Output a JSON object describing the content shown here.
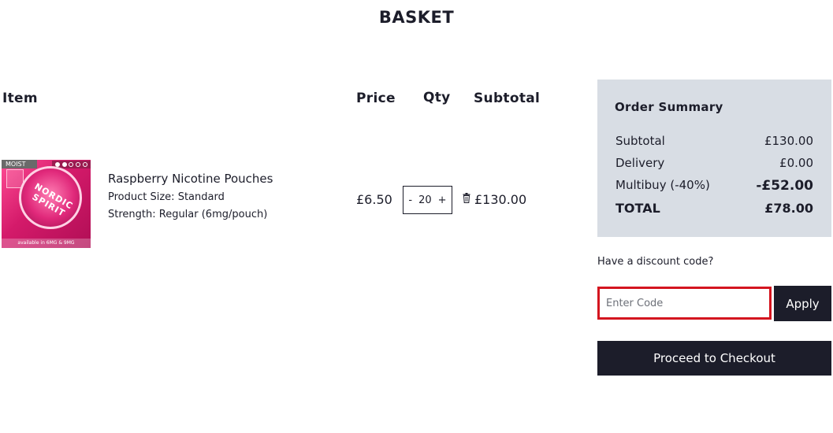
{
  "page": {
    "title": "BASKET"
  },
  "table": {
    "headers": {
      "item": "Item",
      "price": "Price",
      "qty": "Qty",
      "subtotal": "Subtotal"
    },
    "rows": [
      {
        "image": {
          "label": "MOIST",
          "brand": "NORDIC SPIRIT",
          "footer": "available in 6MG & 9MG"
        },
        "name": "Raspberry Nicotine Pouches",
        "size": "Product Size: Standard",
        "strength": "Strength: Regular (6mg/pouch)",
        "price": "£6.50",
        "qty": "20",
        "qty_minus": "-",
        "qty_plus": "+",
        "subtotal": "£130.00"
      }
    ]
  },
  "summary": {
    "title": "Order Summary",
    "subtotal_label": "Subtotal",
    "subtotal_value": "£130.00",
    "delivery_label": "Delivery",
    "delivery_value": "£0.00",
    "multibuy_label": "Multibuy (-40%)",
    "multibuy_value": "-£52.00",
    "total_label": "TOTAL",
    "total_value": "£78.00"
  },
  "discount": {
    "label": "Have a discount code?",
    "placeholder": "Enter Code",
    "value": "",
    "apply_label": "Apply"
  },
  "checkout": {
    "label": "Proceed to Checkout"
  },
  "colors": {
    "dark": "#1c1d2a",
    "summary_bg": "#d8dde4",
    "focus_border": "#d4151f"
  },
  "icons": {
    "remove": "trash-icon"
  }
}
